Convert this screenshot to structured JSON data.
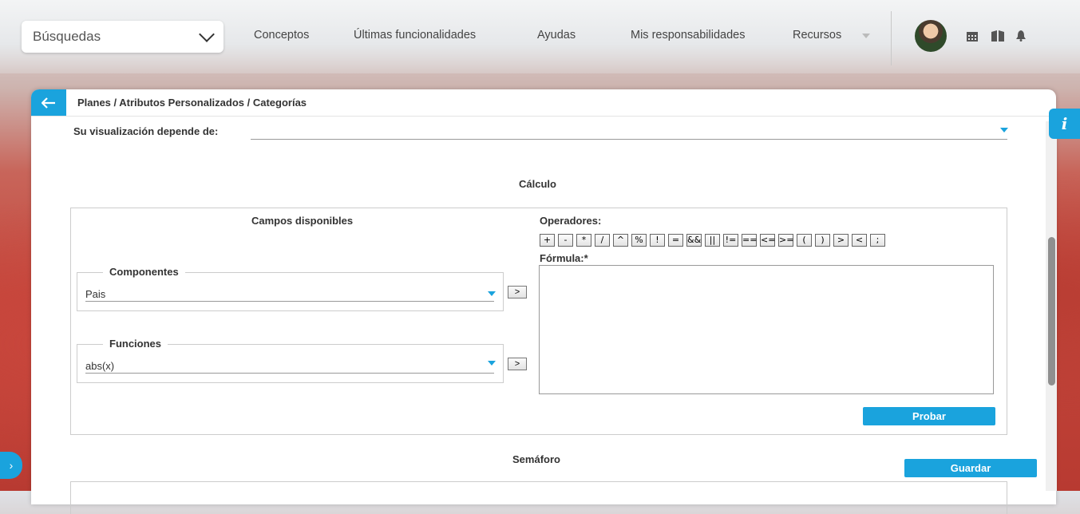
{
  "topbar": {
    "search": {
      "value": "Búsquedas"
    },
    "nav": [
      "Conceptos",
      "Últimas funcionalidades",
      "Ayudas",
      "Mis responsabilidades",
      "Recursos"
    ],
    "icons": [
      "calendar-icon",
      "book-icon",
      "bell-icon"
    ]
  },
  "breadcrumb": "Planes / Atributos Personalizados / Categorías",
  "dependency": {
    "label": "Su visualización depende de:",
    "value": ""
  },
  "calculo": {
    "title": "Cálculo",
    "fields_title": "Campos disponibles",
    "componentes": {
      "legend": "Componentes",
      "value": "Pais",
      "add": ">"
    },
    "funciones": {
      "legend": "Funciones",
      "value": "abs(x)",
      "add": ">"
    },
    "operators_label": "Operadores:",
    "operators": [
      "+",
      "-",
      "*",
      "/",
      "^",
      "%",
      "!",
      "=",
      "&&",
      "||",
      "!=",
      "==",
      "<=",
      ">=",
      "(",
      ")",
      ">",
      "<",
      ";"
    ],
    "formula_label": "Fórmula:*",
    "formula_value": "",
    "test_button": "Probar"
  },
  "semaforo": {
    "title": "Semáforo"
  },
  "save_button": "Guardar",
  "info_tab": "i",
  "colors": {
    "accent": "#1aa3dd"
  }
}
